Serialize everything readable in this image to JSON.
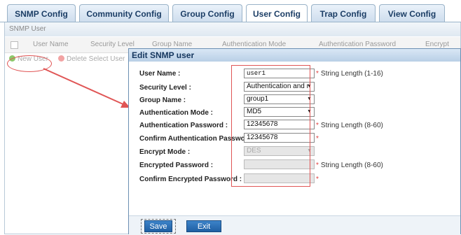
{
  "tabs": [
    {
      "label": "SNMP Config"
    },
    {
      "label": "Community Config"
    },
    {
      "label": "Group Config"
    },
    {
      "label": "User Config"
    },
    {
      "label": "Trap Config"
    },
    {
      "label": "View Config"
    }
  ],
  "panel": {
    "title": "SNMP User",
    "columns": [
      "User Name",
      "Security Level",
      "Group Name",
      "Authentication Mode",
      "Authentication Password",
      "Encrypt Mode"
    ],
    "new_user": "New User",
    "delete_user": "Delete Select User"
  },
  "dialog": {
    "title": "Edit SNMP user",
    "fields": [
      {
        "label": "User Name :",
        "value": "user1",
        "hint": "String Length (1-16)"
      },
      {
        "label": "Security Level :",
        "value": "Authentication and r"
      },
      {
        "label": "Group Name :",
        "value": "group1"
      },
      {
        "label": "Authentication Mode :",
        "value": "MD5"
      },
      {
        "label": "Authentication Password :",
        "value": "12345678",
        "hint": "String Length (8-60)"
      },
      {
        "label": "Confirm Authentication Password :",
        "value": "12345678",
        "hint": ""
      },
      {
        "label": "Encrypt Mode :",
        "value": "DES"
      },
      {
        "label": "Encrypted Password :",
        "value": "",
        "hint": "String Length (8-60)"
      },
      {
        "label": "Confirm Encrypted Password :",
        "value": "",
        "hint": ""
      }
    ],
    "required_mark": "*",
    "save": "Save",
    "exit": "Exit"
  },
  "colors": {
    "accent": "#1f5fa3",
    "annotation": "#e05555"
  }
}
